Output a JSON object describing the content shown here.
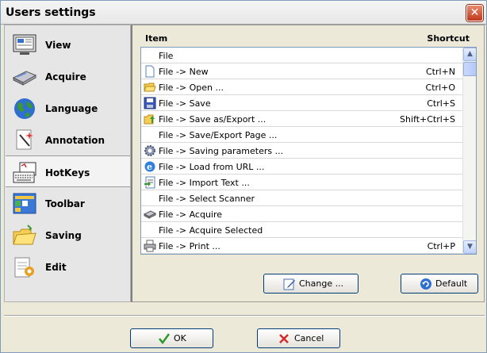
{
  "window": {
    "title": "Users settings"
  },
  "sidebar": {
    "items": [
      {
        "label": "View",
        "icon": "monitor-icon"
      },
      {
        "label": "Acquire",
        "icon": "scanner-icon"
      },
      {
        "label": "Language",
        "icon": "globe-icon"
      },
      {
        "label": "Annotation",
        "icon": "magic-wand-icon"
      },
      {
        "label": "HotKeys",
        "icon": "keyboard-icon",
        "active": true
      },
      {
        "label": "Toolbar",
        "icon": "toolbar-icon"
      },
      {
        "label": "Saving",
        "icon": "folder-save-icon"
      },
      {
        "label": "Edit",
        "icon": "notepad-edit-icon"
      }
    ]
  },
  "hotkeys": {
    "columns": {
      "item": "Item",
      "shortcut": "Shortcut"
    },
    "rows": [
      {
        "label": "File",
        "shortcut": "",
        "icon": "none"
      },
      {
        "label": "File -> New",
        "shortcut": "Ctrl+N",
        "icon": "new-file-icon"
      },
      {
        "label": "File -> Open ...",
        "shortcut": "Ctrl+O",
        "icon": "open-folder-icon"
      },
      {
        "label": "File -> Save",
        "shortcut": "Ctrl+S",
        "icon": "floppy-icon"
      },
      {
        "label": "File -> Save as/Export ...",
        "shortcut": "Shift+Ctrl+S",
        "icon": "save-as-icon"
      },
      {
        "label": "File -> Save/Export Page ...",
        "shortcut": "",
        "icon": "none"
      },
      {
        "label": "File -> Saving parameters ...",
        "shortcut": "",
        "icon": "gear-icon"
      },
      {
        "label": "File -> Load from URL ...",
        "shortcut": "",
        "icon": "browser-icon"
      },
      {
        "label": "File -> Import Text ...",
        "shortcut": "",
        "icon": "import-text-icon"
      },
      {
        "label": "File -> Select Scanner",
        "shortcut": "",
        "icon": "none"
      },
      {
        "label": "File -> Acquire",
        "shortcut": "",
        "icon": "scanner-icon"
      },
      {
        "label": "File -> Acquire Selected",
        "shortcut": "",
        "icon": "none"
      },
      {
        "label": "File -> Print ...",
        "shortcut": "Ctrl+P",
        "icon": "printer-icon"
      }
    ]
  },
  "buttons": {
    "change": "Change ...",
    "default": "Default",
    "ok": "OK",
    "cancel": "Cancel"
  }
}
